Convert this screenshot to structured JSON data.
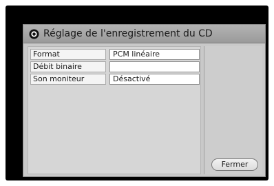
{
  "dialog": {
    "title": "Réglage de l'enregistrement du CD",
    "title_icon": "record-disc-icon"
  },
  "settings": [
    {
      "label": "Format",
      "value": "PCM linéaire"
    },
    {
      "label": "Débit binaire",
      "value": ""
    },
    {
      "label": "Son moniteur",
      "value": "Désactivé"
    }
  ],
  "buttons": {
    "close_label": "Fermer"
  },
  "colors": {
    "screen_bg": "#000000",
    "dialog_bg": "#c9c9c9",
    "titlebar_bg": "#a6a6a6"
  }
}
